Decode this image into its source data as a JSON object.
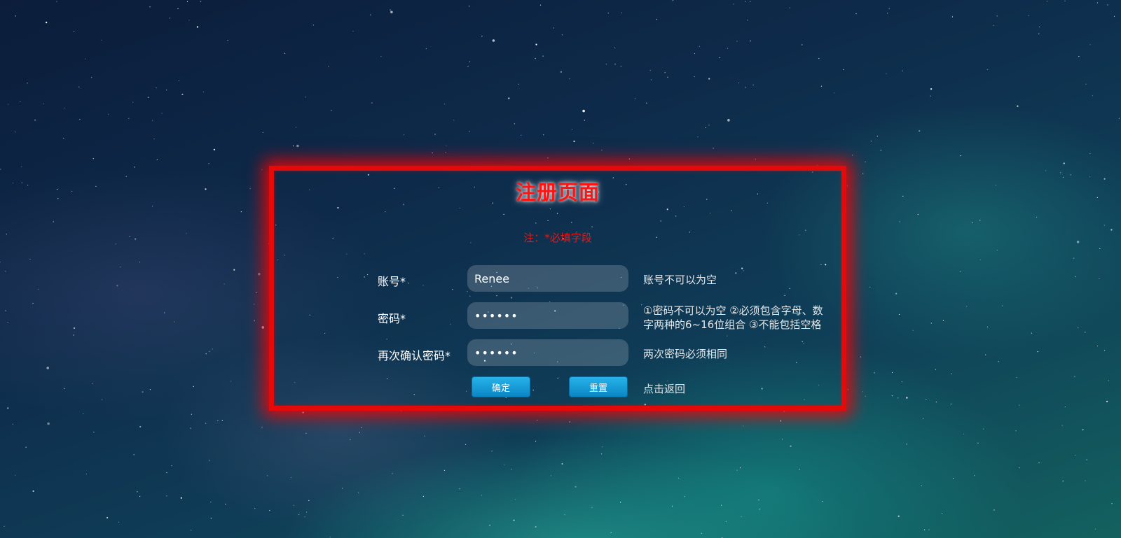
{
  "form": {
    "title": "注册页面",
    "required_note": "注：*必填字段",
    "fields": [
      {
        "label": "账号*",
        "value": "Renee",
        "type": "text",
        "hint": "账号不可以为空"
      },
      {
        "label": "密码*",
        "value": "••••••",
        "type": "password",
        "hint_line1": "①密码不可以为空 ②必须包含字母、数",
        "hint_line2": "字两种的6~16位组合 ③不能包括空格"
      },
      {
        "label": "再次确认密码*",
        "value": "••••••",
        "type": "password",
        "hint": "两次密码必须相同"
      }
    ],
    "confirm_label": "确定",
    "reset_label": "重置",
    "back_label": "点击返回"
  },
  "colors": {
    "frame": "#e50a0a",
    "title": "#ff1414",
    "note": "#e01a1a",
    "button": "#0a86c4"
  }
}
